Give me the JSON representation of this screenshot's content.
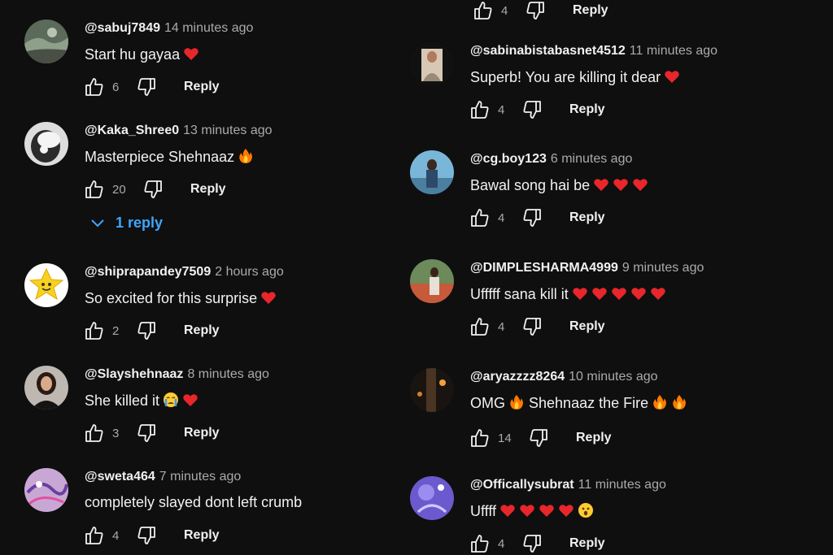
{
  "colors": {
    "background": "#0f0f0f",
    "text_primary": "#f1f1f1",
    "text_secondary": "#aaaaaa",
    "link_blue": "#3ea6ff",
    "heart_red": "#e8262b",
    "fire_orange": "#ff7a00"
  },
  "labels": {
    "reply": "Reply"
  },
  "top_partial": {
    "likes": "4"
  },
  "left_column": [
    {
      "author": "@sabuj7849",
      "time": "14 minutes ago",
      "text": "Start hu gayaa",
      "emoji": [
        "heart"
      ],
      "likes": "6"
    },
    {
      "author": "@Kaka_Shree0",
      "time": "13 minutes ago",
      "text": "Masterpiece  Shehnaaz",
      "emoji": [
        "fire"
      ],
      "likes": "20",
      "replies_label": "1 reply"
    },
    {
      "author": "@shiprapandey7509",
      "time": "2 hours ago",
      "text": "So excited for this surprise",
      "emoji": [
        "heart"
      ],
      "likes": "2"
    },
    {
      "author": "@Slayshehnaaz",
      "time": "8 minutes ago",
      "text": "She killed it",
      "emoji": [
        "crying",
        "heart"
      ],
      "likes": "3"
    },
    {
      "author": "@sweta464",
      "time": "7 minutes ago",
      "text": "completely slayed dont left crumb",
      "emoji": [],
      "likes": "4"
    }
  ],
  "right_column": [
    {
      "author": "@sabinabistabasnet4512",
      "time": "11 minutes ago",
      "text": "Superb! You are killing it dear",
      "emoji": [
        "heart"
      ],
      "likes": "4"
    },
    {
      "author": "@cg.boy123",
      "time": "6 minutes ago",
      "text": "Bawal song hai be",
      "emoji": [
        "heart",
        "heart",
        "heart"
      ],
      "likes": "4"
    },
    {
      "author": "@DIMPLESHARMA4999",
      "time": "9 minutes ago",
      "text": "Ufffff sana kill it",
      "emoji": [
        "heart",
        "heart",
        "heart",
        "heart",
        "heart"
      ],
      "likes": "4"
    },
    {
      "author": "@aryazzzz8264",
      "time": "10 minutes ago",
      "text": "OMG",
      "text2": "Shehnaaz the Fire",
      "emoji": [
        "fire"
      ],
      "emoji2": [
        "fire",
        "fire"
      ],
      "likes": "14"
    },
    {
      "author": "@Officallysubrat",
      "time": "11 minutes ago",
      "text": "Uffff",
      "emoji": [
        "heart",
        "heart",
        "heart",
        "heart",
        "wow"
      ],
      "likes": "4"
    }
  ]
}
